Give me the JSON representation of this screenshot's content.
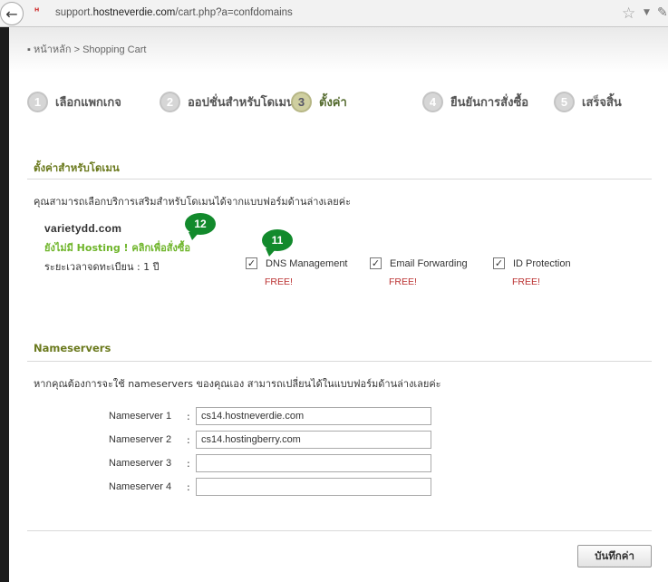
{
  "browser": {
    "url_prefix": "support.",
    "url_domain": "hostneverdie.com",
    "url_path": "/cart.php?a=confdomains"
  },
  "breadcrumb": "▪ หน้าหลัก > Shopping Cart",
  "steps": [
    {
      "num": "1",
      "label": "เลือกแพกเกจ"
    },
    {
      "num": "2",
      "label": "ออปชั่นสำหรับโดเมน"
    },
    {
      "num": "3",
      "label": "ตั้งค่า"
    },
    {
      "num": "4",
      "label": "ยืนยันการสั่งซื้อ"
    },
    {
      "num": "5",
      "label": "เสร็จสิ้น"
    }
  ],
  "domain_config": {
    "title": "ตั้งค่าสำหรับโดเมน",
    "intro": "คุณสามารถเลือกบริการเสริมสำหรับโดเมนได้จากแบบฟอร์มด้านล่างเลยค่ะ",
    "domain_name": "varietydd.com",
    "hosting_link": "ยังไม่มี Hosting ! คลิกเพื่อสั่งซื้อ",
    "period": "ระยะเวลาจดทะเบียน : 1 ปี",
    "addons": [
      {
        "label": "DNS Management",
        "price": "FREE!",
        "checked": true
      },
      {
        "label": "Email Forwarding",
        "price": "FREE!",
        "checked": true
      },
      {
        "label": "ID Protection",
        "price": "FREE!",
        "checked": true
      }
    ],
    "bubbles": [
      "12",
      "11"
    ]
  },
  "nameservers": {
    "title": "Nameservers",
    "intro": "หากคุณต้องการจะใช้ nameservers ของคุณเอง สามารถเปลี่ยนได้ในแบบฟอร์มด้านล่างเลยค่ะ",
    "rows": [
      {
        "label": "Nameserver 1",
        "value": "cs14.hostneverdie.com"
      },
      {
        "label": "Nameserver 2",
        "value": "cs14.hostingberry.com"
      },
      {
        "label": "Nameserver 3",
        "value": ""
      },
      {
        "label": "Nameserver 4",
        "value": ""
      }
    ]
  },
  "save_label": "บันทึกค่า",
  "colors": {
    "accent": "#6b7a1e",
    "hosting_link": "#6fb52b",
    "free": "#bb3333",
    "bubble": "#128a2c"
  }
}
